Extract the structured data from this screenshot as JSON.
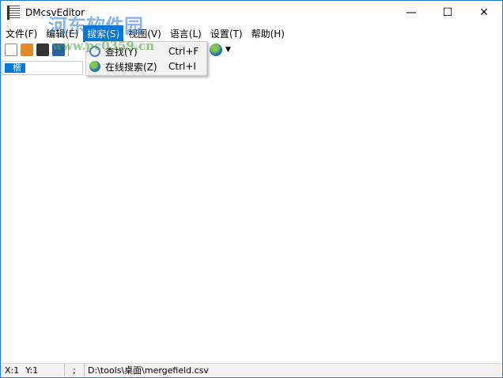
{
  "window": {
    "title": "DMcsvEditor",
    "minimize": "—",
    "maximize": "☐",
    "close": "✕"
  },
  "menu": [
    {
      "label": "文件(F)"
    },
    {
      "label": "编辑(E)"
    },
    {
      "label": "搜索(S)"
    },
    {
      "label": "视图(V)"
    },
    {
      "label": "语言(L)"
    },
    {
      "label": "设置(T)"
    },
    {
      "label": "帮助(H)"
    }
  ],
  "search_menu": [
    {
      "label": "查找(Y)",
      "shortcut": "Ctrl+F",
      "icon": "magnifier-icon"
    },
    {
      "label": "在线搜索(Z)",
      "shortcut": "Ctrl+I",
      "icon": "globe-icon"
    }
  ],
  "cell": {
    "value": "楷"
  },
  "status": {
    "x": "X:1",
    "y": "Y:1",
    "separator": ";",
    "path": "D:\\tools\\桌面\\mergefield.csv"
  },
  "watermark": {
    "name": "河东软件园",
    "url": "www.pc0359.cn"
  },
  "colors": {
    "accent": "#0078d7",
    "border": "#1e7ad6"
  }
}
